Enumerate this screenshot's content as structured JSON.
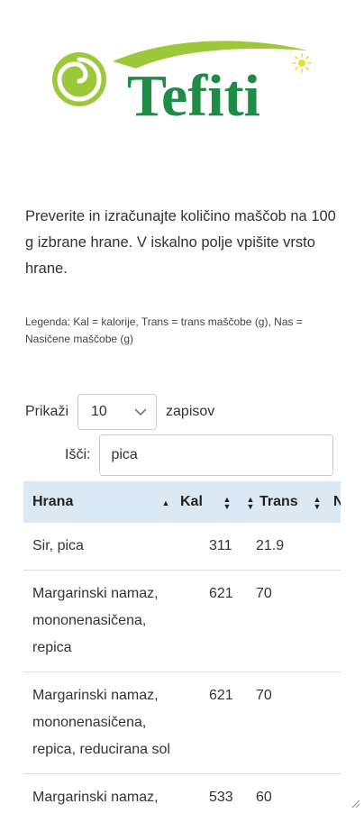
{
  "logo": {
    "text": "Tefiti",
    "brand_color": "#1e8c44",
    "accent_color": "#9bc93a"
  },
  "intro": {
    "text": "Preverite in izračunajte količino maščob na 100 g izbrane hrane. V iskalno polje vpišite vrsto hrane."
  },
  "legend": {
    "text": "Legenda: Kal = kalorije, Trans = trans maščobe (g), Nas = Nasičene maščobe (g)"
  },
  "controls": {
    "show_label": "Prikaži",
    "page_size": "10",
    "records_label": "zapisov",
    "search_label": "Išči:",
    "search_value": "pica"
  },
  "table": {
    "headers": [
      "Hrana",
      "Kal",
      "Trans",
      "N"
    ],
    "header_bg": "#dbe9f5",
    "rows": [
      {
        "food": "Sir, pica",
        "kal": "311",
        "trans": "21.9"
      },
      {
        "food": "Margarinski namaz, mononenasičena, repica",
        "kal": "621",
        "trans": "70"
      },
      {
        "food": "Margarinski namaz, mononenasičena, repica, reducirana sol",
        "kal": "621",
        "trans": "70"
      },
      {
        "food": "Margarinski namaz,",
        "kal": "533",
        "trans": "60"
      }
    ]
  }
}
